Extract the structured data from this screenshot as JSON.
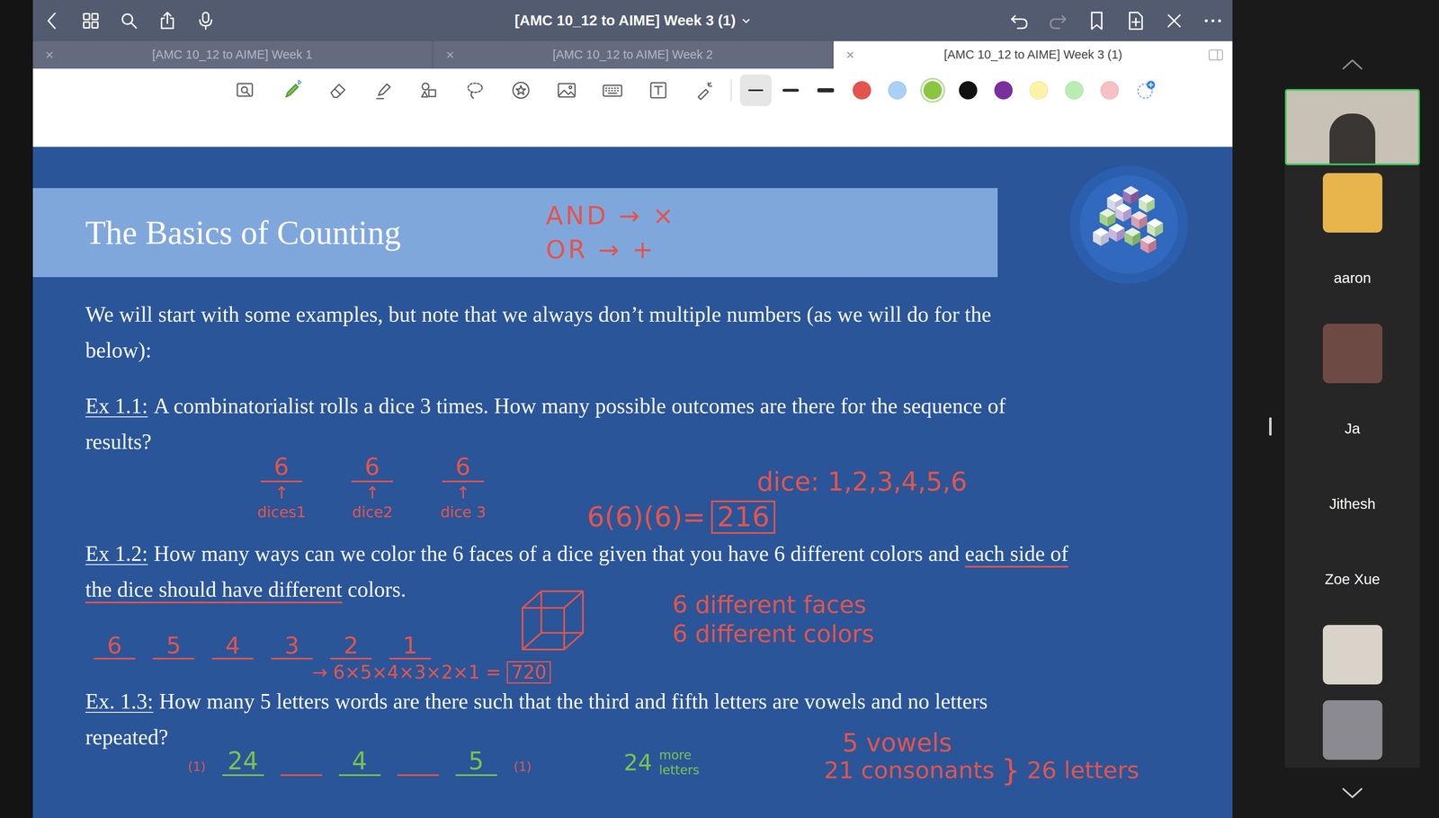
{
  "window": {
    "title": "[AMC 10_12 to AIME] Week 3 (1)"
  },
  "toolbar": {
    "redo": {
      "disabled": true
    }
  },
  "tabs": [
    {
      "label": "[AMC 10_12 to AIME] Week 1",
      "selected": false
    },
    {
      "label": "[AMC 10_12 to AIME] Week 2",
      "selected": false
    },
    {
      "label": "[AMC 10_12 to AIME] Week 3 (1)",
      "selected": true
    }
  ],
  "tools": [
    {
      "selected": false
    },
    {
      "selected": true
    },
    {
      "selected": false
    },
    {
      "selected": false
    },
    {
      "selected": false
    },
    {
      "selected": false
    },
    {
      "selected": false
    },
    {
      "selected": false
    },
    {
      "selected": false
    },
    {
      "selected": false
    },
    {
      "selected": false
    }
  ],
  "stroke_widths": [
    {
      "selected": true
    },
    {
      "selected": false
    },
    {
      "selected": false
    }
  ],
  "colors": [
    {
      "color": "#e4544c",
      "selected": false
    },
    {
      "color": "#a9d0f5",
      "selected": false
    },
    {
      "color": "#8cc63f",
      "selected": true
    },
    {
      "color": "#111111",
      "selected": false
    },
    {
      "color": "#7a2f9e",
      "selected": false
    },
    {
      "color": "#fbf3a6",
      "selected": false
    },
    {
      "color": "#b9eeb3",
      "selected": false
    },
    {
      "color": "#f6c0c4",
      "selected": false
    }
  ],
  "page": {
    "title": "The Basics of Counting",
    "paragraphs": [
      {
        "lines": [
          [
            {
              "text": "We will start with some examples, but note that we always don’t multiple numbers (as we will do for the",
              "underlined": false
            }
          ],
          [
            {
              "text": "below):",
              "underlined": false
            }
          ]
        ]
      },
      {
        "label": "Ex 1.1:",
        "lines": [
          [
            {
              "text": "A combinatorialist rolls a dice 3 times. How many possible outcomes are there for the sequence of",
              "underlined": false
            }
          ],
          [
            {
              "text": "results?",
              "underlined": false
            }
          ]
        ]
      },
      {
        "label": "Ex 1.2:",
        "lines": [
          [
            {
              "text": "How many ways can we color the 6 faces of a dice given that you have 6 different colors and ",
              "underlined": false
            },
            {
              "text": "each side of",
              "underlined": true
            }
          ],
          [
            {
              "text": "the dice should have different",
              "underlined": true
            },
            {
              "text": " colors.",
              "underlined": false
            }
          ]
        ]
      },
      {
        "label": "Ex. 1.3:",
        "lines": [
          [
            {
              "text": "How many 5 letters words are there such that the third and fifth letters are vowels and no letters",
              "underlined": false
            }
          ],
          [
            {
              "text": "repeated?",
              "underlined": false
            }
          ]
        ]
      }
    ]
  },
  "annotations": {
    "rules": [
      "AND → ×",
      "OR → +"
    ],
    "dice_slots": [
      {
        "value": "6",
        "arrow": "↑",
        "label": "dices1"
      },
      {
        "value": "6",
        "arrow": "↑",
        "label": "dice2"
      },
      {
        "value": "6",
        "arrow": "↑",
        "label": "dice 3"
      }
    ],
    "dice_product": {
      "expr": "6(6)(6)=",
      "answer": "216"
    },
    "dice_faces": "dice: 1,2,3,4,5,6",
    "color_notes": [
      "6 different faces",
      "6 different colors"
    ],
    "color_slots": [
      "6",
      "5",
      "4",
      "3",
      "2",
      "1"
    ],
    "color_product": {
      "expr": "→ 6×5×4×3×2×1 =",
      "answer": "720"
    },
    "letter_counts": {
      "vowels": "5 vowels",
      "consonants": "21 consonants",
      "brace": "}",
      "total": "26 letters"
    },
    "word_slots": [
      {
        "kind": "tag",
        "text": "(1)",
        "color": "#e4544c"
      },
      {
        "kind": "slot",
        "text": "24",
        "color": "#7cc24e"
      },
      {
        "kind": "slot",
        "text": "",
        "color": "#e4544c"
      },
      {
        "kind": "slot",
        "text": "4",
        "color": "#7cc24e"
      },
      {
        "kind": "slot",
        "text": "",
        "color": "#e4544c"
      },
      {
        "kind": "slot",
        "text": "5",
        "color": "#7cc24e"
      },
      {
        "kind": "tag",
        "text": "(1)",
        "color": "#e4544c"
      }
    ],
    "remaining": {
      "number": "24",
      "lines": [
        "more",
        "letters"
      ]
    }
  },
  "participants": [
    {
      "kind": "video",
      "speaking": true
    },
    {
      "kind": "avatar",
      "color": "#e7b54c"
    },
    {
      "kind": "name",
      "name": "aaron"
    },
    {
      "kind": "avatar",
      "color": "#6e4a44"
    },
    {
      "kind": "name",
      "name": "Ja"
    },
    {
      "kind": "name",
      "name": "Jithesh"
    },
    {
      "kind": "name",
      "name": "Zoe Xue"
    },
    {
      "kind": "avatar",
      "color": "#d9d3c9"
    },
    {
      "kind": "avatar",
      "color": "#8b8a90"
    }
  ]
}
